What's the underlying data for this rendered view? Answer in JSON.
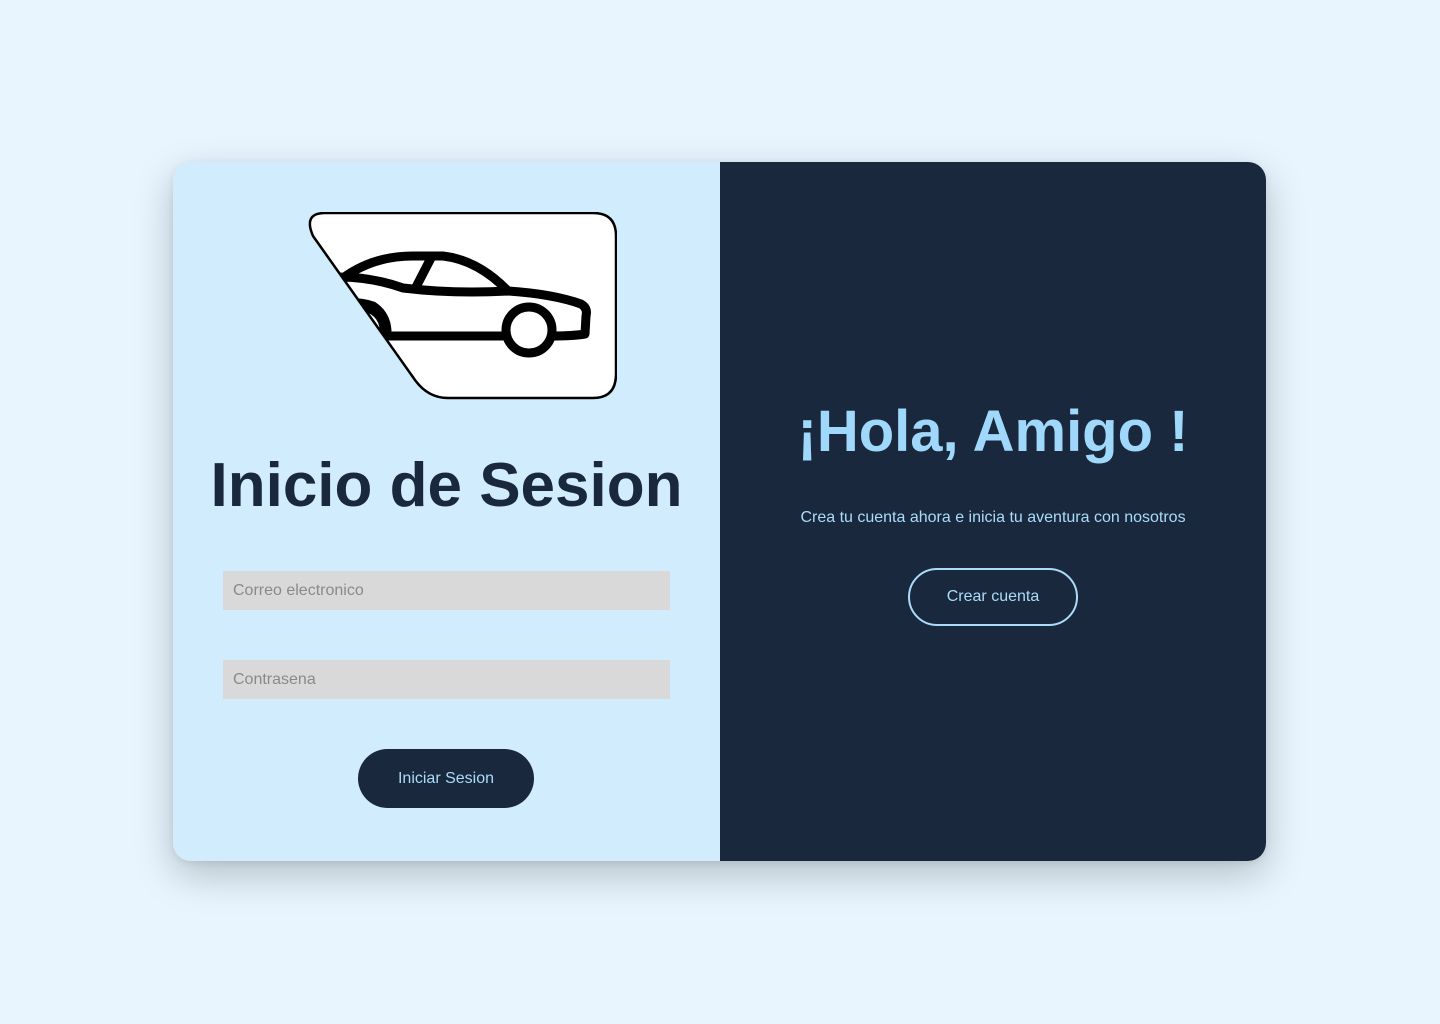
{
  "login": {
    "logo_icon": "car-icon",
    "title": "Inicio de Sesion",
    "email_placeholder": "Correo electronico",
    "password_placeholder": "Contrasena",
    "submit_label": "Iniciar Sesion"
  },
  "register": {
    "title": "¡Hola, Amigo !",
    "subtitle": "Crea tu cuenta ahora e inicia tu aventura con nosotros",
    "button_label": "Crear cuenta"
  },
  "colors": {
    "page_background": "#e8f5fe",
    "left_panel": "#d1edfd",
    "right_panel": "#19283d",
    "accent_light": "#a9dcf8",
    "input_background": "#d9d9d9"
  }
}
